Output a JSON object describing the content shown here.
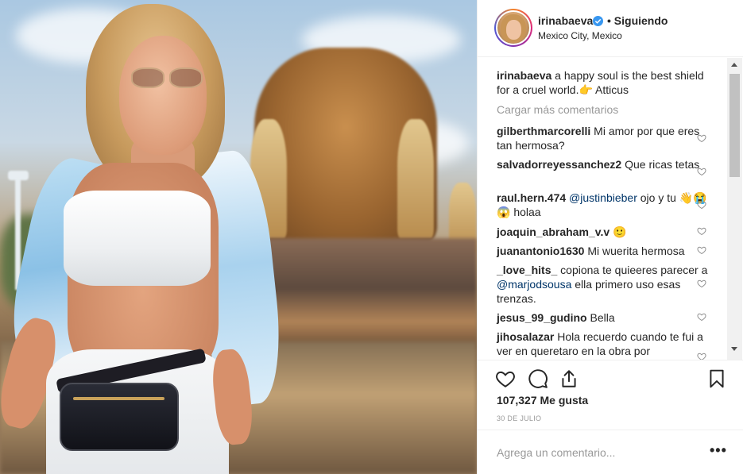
{
  "header": {
    "username": "irinabaeva",
    "following_label": "• Siguiendo",
    "location": "Mexico City, Mexico"
  },
  "caption": {
    "username": "irinabaeva",
    "text": " a happy soul is the best shield for a cruel world.👉 Atticus"
  },
  "load_more_label": "Cargar más comentarios",
  "comments": [
    {
      "username": "gilberthmarcorelli",
      "text": " Mi amor por que eres tan hermosa?"
    },
    {
      "username": "salvadorreyessanchez2",
      "text": " Que ricas tetas"
    },
    {
      "username": "raul.hern.474",
      "mention": " @justinbieber",
      "text": " ojo y tu 👋😭😱 holaa"
    },
    {
      "username": "joaquin_abraham_v.v",
      "text": " 🙂"
    },
    {
      "username": "juanantonio1630",
      "text": " Mi wuerita hermosa"
    },
    {
      "username": "_love_hits_",
      "text": " copiona te quieeres parecer a ",
      "mention": "@marjodsousa",
      "text2": " ella primero uso esas trenzas."
    },
    {
      "username": "jesus_99_gudino",
      "text": " Bella"
    },
    {
      "username": "jihosalazar",
      "text": " Hola recuerdo cuando te fui a ver en queretaro en la obra por"
    }
  ],
  "likes_label": "107,327 Me gusta",
  "date_label": "30 DE JULIO",
  "add_comment_placeholder": "Agrega un comentario...",
  "more_label": "•••",
  "icons": {
    "verified": "verified-badge-icon",
    "like": "heart-outline-icon",
    "comment": "comment-bubble-icon",
    "share": "share-upload-icon",
    "save": "bookmark-icon"
  },
  "colors": {
    "verified_blue": "#3897f0",
    "mention_blue": "#003569",
    "muted": "#999999"
  }
}
